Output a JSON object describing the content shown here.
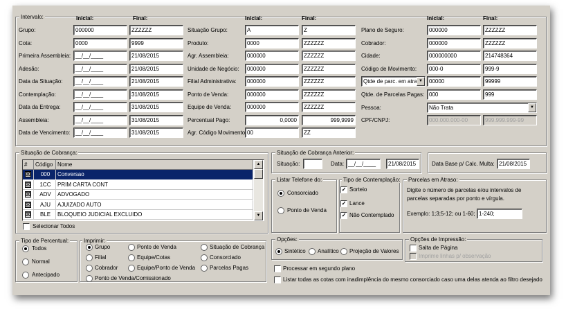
{
  "intervalo": {
    "title": "Intervalo:",
    "hdr_inicial": "Inicial:",
    "hdr_final": "Final:",
    "col1": [
      {
        "label": "Grupo:",
        "inicial": "000000",
        "final": "ZZZZZZ"
      },
      {
        "label": "Cota:",
        "inicial": "0000",
        "final": "9999"
      },
      {
        "label": "Primeira Assembleia:",
        "inicial": "__/__/____",
        "final": "21/08/2015"
      },
      {
        "label": "Adesão:",
        "inicial": "__/__/____",
        "final": "21/08/2015"
      },
      {
        "label": "Data da Situação:",
        "inicial": "__/__/____",
        "final": "21/08/2015"
      },
      {
        "label": "Contemplação:",
        "inicial": "__/__/____",
        "final": "31/08/2015"
      },
      {
        "label": "Data da Entrega:",
        "inicial": "__/__/____",
        "final": "31/08/2015"
      },
      {
        "label": "Assembleia:",
        "inicial": "__/__/____",
        "final": "31/08/2015"
      },
      {
        "label": "Data de Vencimento:",
        "inicial": "__/__/____",
        "final": "31/08/2015"
      }
    ],
    "col2": [
      {
        "label": "Situação Grupo:",
        "inicial": "A",
        "final": "Z"
      },
      {
        "label": "Produto:",
        "inicial": "0000",
        "final": "ZZZZZZ"
      },
      {
        "label": "Agr. Assembleia:",
        "inicial": "000000",
        "final": "ZZZZZZ"
      },
      {
        "label": "Unidade de Negócio:",
        "inicial": "000000",
        "final": "ZZZZZZ"
      },
      {
        "label": "Filial Administrativa:",
        "inicial": "000000",
        "final": "ZZZZZZ"
      },
      {
        "label": "Ponto de Venda:",
        "inicial": "000000",
        "final": "ZZZZZZ"
      },
      {
        "label": "Equipe de Venda:",
        "inicial": "000000",
        "final": "ZZZZZZ"
      },
      {
        "label": "Percentual Pago:",
        "inicial": "0,0000",
        "final": "999,9999"
      },
      {
        "label": "Agr. Código Movimento:",
        "inicial": "00",
        "final": "ZZ"
      }
    ],
    "col3": [
      {
        "label": "Plano de Seguro:",
        "inicial": "000000",
        "final": "ZZZZZZ"
      },
      {
        "label": "Cobrador:",
        "inicial": "000000",
        "final": "ZZZZZZ"
      },
      {
        "label": "Cidade:",
        "inicial": "000000000",
        "final": "214748364"
      },
      {
        "label": "Código de Movimento:",
        "inicial": "000-0",
        "final": "999-9"
      },
      {
        "label": "Qtde de parc. em atra",
        "inicial": "00000",
        "final": "99999"
      },
      {
        "label": "Qtde. de Parcelas Pagas:",
        "inicial": "000",
        "final": "999"
      }
    ],
    "pessoa": {
      "label": "Pessoa:",
      "value": "Não Trata"
    },
    "cpf": {
      "label": "CPF/CNPJ:",
      "inicial": "000.000.000-00",
      "final": "999.999.999-99"
    }
  },
  "situacao_cobranca": {
    "title": "Situação de Cobrança:",
    "columns": [
      "#",
      "Código",
      "Nome"
    ],
    "rows": [
      {
        "codigo": "000",
        "nome": "Conversao",
        "checked": "☒"
      },
      {
        "codigo": "1CC",
        "nome": "PRIM CARTA CONT",
        "checked": "☒"
      },
      {
        "codigo": "ADV",
        "nome": "ADVOGADO",
        "checked": "☒"
      },
      {
        "codigo": "AJU",
        "nome": "AJUIZADO AUTO",
        "checked": "☒"
      },
      {
        "codigo": "BLE",
        "nome": "BLOQUEIO JUDICIAL EXCLUIDO",
        "checked": "☒"
      }
    ],
    "selecionar_todos": "Selecionar Todos"
  },
  "situacao_anterior": {
    "title": "Situação de Cobrança Anterior:",
    "situacao_label": "Situação:",
    "situacao_value": "",
    "data_label": "Data:",
    "data_inicial": "__/__/____",
    "data_final": "21/08/2015"
  },
  "data_base": {
    "label": "Data Base p/ Calc. Multa:",
    "value": "21/08/2015"
  },
  "listar_telefone": {
    "title": "Listar Telefone do:",
    "options": [
      "Consorciado",
      "Ponto de Venda"
    ],
    "selected": 0
  },
  "tipo_contemplacao": {
    "title": "Tipo de Contemplação:",
    "options": [
      "Sorteio",
      "Lance",
      "Não Contemplado"
    ]
  },
  "parcelas_atraso": {
    "title": "Parcelas em Atraso:",
    "text": "Digite o número de parcelas e/ou intervalos de parcelas separadas por ponto e vírgula.",
    "example_label": "Exemplo: 1;3;5-12; ou 1-60;",
    "value": "1-240;"
  },
  "tipo_percentual": {
    "title": "Tipo de Percentual:",
    "options": [
      "Todos",
      "Normal",
      "Antecipado"
    ],
    "selected": 0
  },
  "imprimir": {
    "title": "Imprimir:",
    "options": [
      "Grupo",
      "Ponto de Venda",
      "Situação de Cobrança",
      "Filial",
      "Equipe/Cotas",
      "Consorciado",
      "Cobrador",
      "Equipe/Ponto de Venda",
      "Parcelas Pagas",
      "Ponto de Venda/Comissionado"
    ],
    "selected": 0
  },
  "opcoes": {
    "title": "Opções:",
    "options": [
      "Sintético",
      "Analítico",
      "Projeção de Valores"
    ],
    "selected": 0
  },
  "opcoes_impressao": {
    "title": "Opções de Impressão:",
    "salta_pagina": "Salta de Página",
    "imprime_linhas": "Imprime linhas p/ observação"
  },
  "processar_segundo_plano": "Processar em segundo plano",
  "listar_todas": "Listar todas as cotas com inadimplência do mesmo consorciado caso uma delas atenda ao filtro desejado",
  "ui": {
    "check": "✓",
    "radio_note": "",
    "arrow_down": "▼",
    "arrow_up": "▲"
  }
}
